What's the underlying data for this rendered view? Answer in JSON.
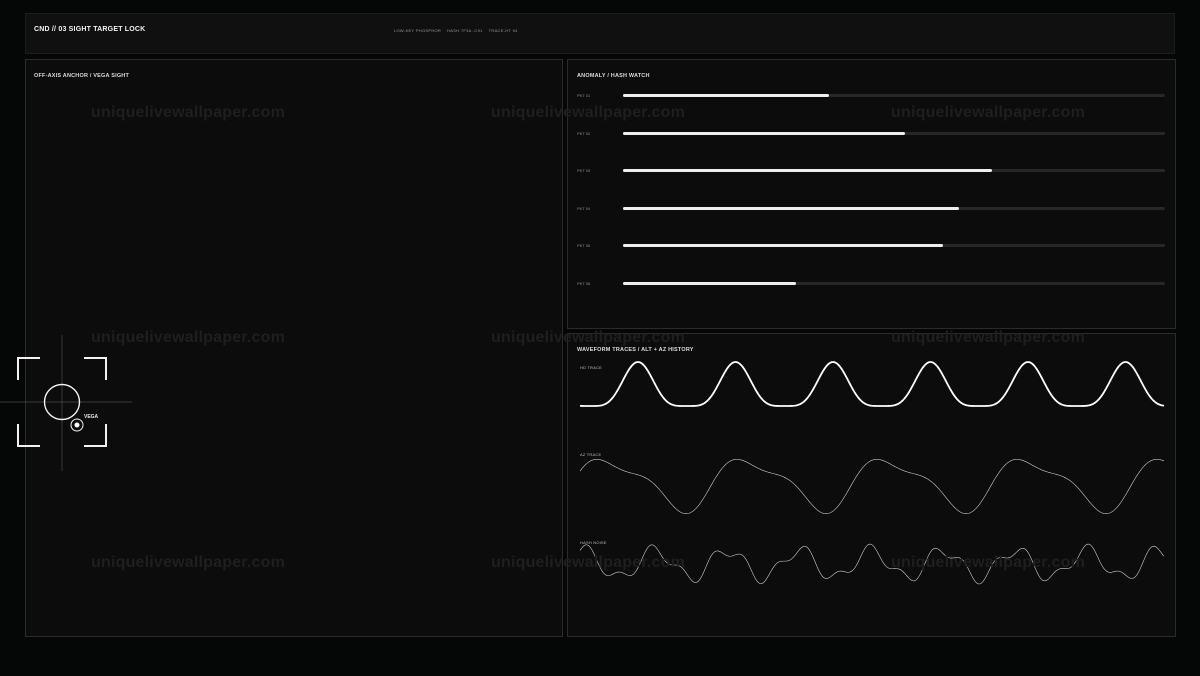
{
  "header": {
    "title": "CND // 03  SIGHT TARGET LOCK",
    "status": [
      "LOW-KEY PHOSPHOR",
      "HASH 7F3A..C91",
      "TRACE-HT 94"
    ]
  },
  "left_panel": {
    "title": "OFF-AXIS ANCHOR  /  VEGA SIGHT",
    "target_label": "VEGA"
  },
  "anomaly_panel": {
    "title": "ANOMALY / HASH WATCH",
    "rows": [
      {
        "label": "PKT 01",
        "value": 0.38
      },
      {
        "label": "PKT 02",
        "value": 0.52
      },
      {
        "label": "PKT 03",
        "value": 0.68
      },
      {
        "label": "PKT 04",
        "value": 0.62
      },
      {
        "label": "PKT 05",
        "value": 0.59
      },
      {
        "label": "PKT 06",
        "value": 0.32
      }
    ]
  },
  "wave_panel": {
    "title": "WAVEFORM TRACES  /  ALT + AZ HISTORY",
    "traces": [
      "HD TRACE",
      "AZ TRACE",
      "HASH NOISE"
    ]
  },
  "watermark": "uniquelivewallpaper.com",
  "colors": {
    "background": "#050606",
    "panel": "#0b0c0b",
    "accent": "#efefef",
    "track": "#262726"
  }
}
